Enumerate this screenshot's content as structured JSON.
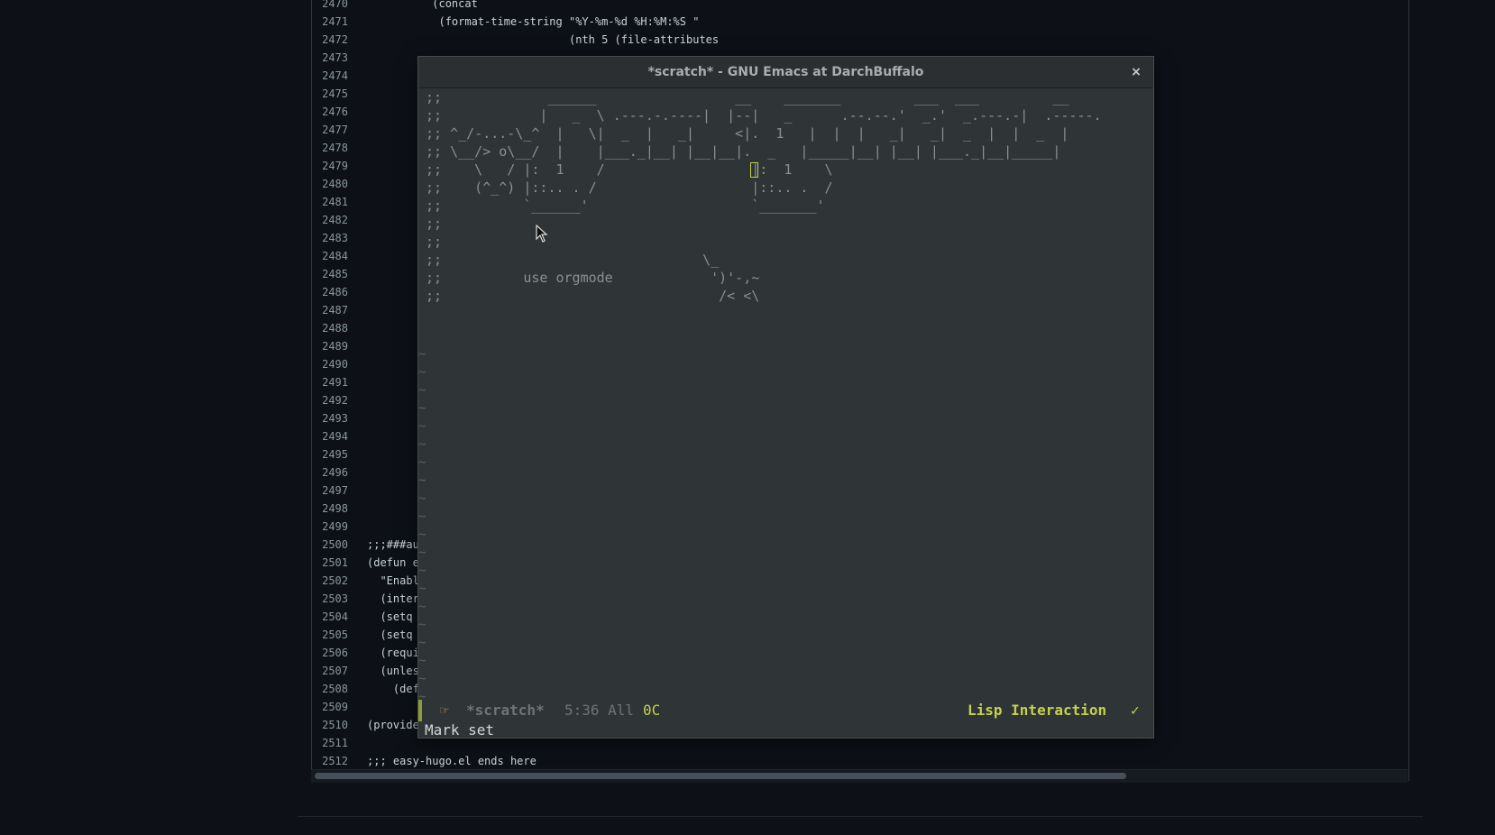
{
  "code": {
    "lines": [
      {
        "n": "2470",
        "t": "          (concat"
      },
      {
        "n": "2471",
        "t": "           (format-time-string \"%Y-%m-%d %H:%M:%S \""
      },
      {
        "n": "2472",
        "t": "                               (nth 5 (file-attributes"
      },
      {
        "n": "2473",
        "t": ""
      },
      {
        "n": "2474",
        "t": ""
      },
      {
        "n": "2475",
        "t": ""
      },
      {
        "n": "2476",
        "t": ""
      },
      {
        "n": "2477",
        "t": ""
      },
      {
        "n": "2478",
        "t": ""
      },
      {
        "n": "2479",
        "t": ""
      },
      {
        "n": "2480",
        "t": ""
      },
      {
        "n": "2481",
        "t": ""
      },
      {
        "n": "2482",
        "t": ""
      },
      {
        "n": "2483",
        "t": ""
      },
      {
        "n": "2484",
        "t": ""
      },
      {
        "n": "2485",
        "t": ""
      },
      {
        "n": "2486",
        "t": ""
      },
      {
        "n": "2487",
        "t": ""
      },
      {
        "n": "2488",
        "t": ""
      },
      {
        "n": "2489",
        "t": ""
      },
      {
        "n": "2490",
        "t": ""
      },
      {
        "n": "2491",
        "t": ""
      },
      {
        "n": "2492",
        "t": ""
      },
      {
        "n": "2493",
        "t": ""
      },
      {
        "n": "2494",
        "t": ""
      },
      {
        "n": "2495",
        "t": ""
      },
      {
        "n": "2496",
        "t": ""
      },
      {
        "n": "2497",
        "t": ""
      },
      {
        "n": "2498",
        "t": ""
      },
      {
        "n": "2499",
        "t": ""
      },
      {
        "n": "2500",
        "t": ";;;###au"
      },
      {
        "n": "2501",
        "t": "(defun e"
      },
      {
        "n": "2502",
        "t": "  \"Enabl"
      },
      {
        "n": "2503",
        "t": "  (inter"
      },
      {
        "n": "2504",
        "t": "  (setq"
      },
      {
        "n": "2505",
        "t": "  (setq"
      },
      {
        "n": "2506",
        "t": "  (requi"
      },
      {
        "n": "2507",
        "t": "  (unles"
      },
      {
        "n": "2508",
        "t": "    (def"
      },
      {
        "n": "2509",
        "t": ""
      },
      {
        "n": "2510",
        "t": "(provide"
      },
      {
        "n": "2511",
        "t": ""
      },
      {
        "n": "2512",
        "t": ";;; easy-hugo.el ends here"
      }
    ]
  },
  "emacs": {
    "title": "*scratch* - GNU Emacs at DarchBuffalo",
    "close": "×",
    "ascii_lines": [
      ";;             ______                 __    _______         ___  ___         __",
      ";;            |   _  \\ .---.-.----|  |--|   _      .--.--.'  _.'  _.---.-|  .-----.",
      ";; ^_/-...-\\_^  |   \\|  _  |   _|     <|.  1   |  |  |   _|   _|  _  |  |  _  |",
      ";; \\__/> o\\__/  |    |___._|__| |__|__|.  _   |_____|__| |__| |___._|__|_____|",
      ";;    \\   / |:  1    /                  |:  1    \\",
      ";;    (^_^) |::.. . /                   |::.. .  /",
      ";;          `______'                    `_______'",
      ";;",
      ";;",
      ";;                                \\_",
      ";;          use orgmode            ')'-,~",
      ";;                                  /< <\\"
    ],
    "tilde": "~",
    "modeline": {
      "icon": "☞",
      "buffer": "*scratch*",
      "position": "5:36 All",
      "column": "0C",
      "mode": "Lisp Interaction",
      "check": "✓"
    },
    "echo": "Mark set"
  }
}
